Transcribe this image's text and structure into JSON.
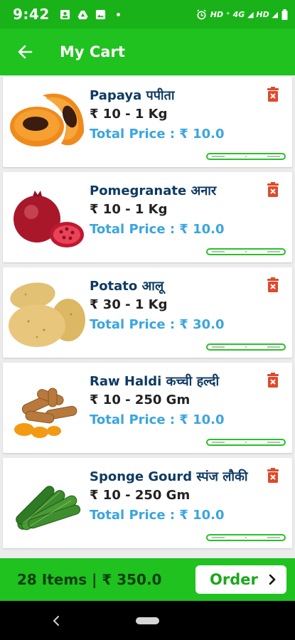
{
  "status_bar": {
    "time": "9:42",
    "right_label": "HD ⁺ 4G ◢ HD ◢"
  },
  "app_bar": {
    "title": "My Cart",
    "back_icon": "arrow-back-icon"
  },
  "cart_items": [
    {
      "name": "Papaya पपीता",
      "unit_price": "₹ 10 - 1 Kg",
      "total": "Total Price : ₹ 10.0",
      "image": "papaya-image"
    },
    {
      "name": "Pomegranate अनार",
      "unit_price": "₹ 10 - 1 Kg",
      "total": "Total Price : ₹ 10.0",
      "image": "pomegranate-image"
    },
    {
      "name": "Potato आलू",
      "unit_price": "₹ 30 - 1 Kg",
      "total": "Total Price : ₹ 30.0",
      "image": "potato-image"
    },
    {
      "name": "Raw Haldi कच्ची हल्दी",
      "unit_price": "₹ 10 - 250 Gm",
      "total": "Total Price : ₹ 10.0",
      "image": "raw-haldi-image"
    },
    {
      "name": "Sponge Gourd स्पंज लौकी",
      "unit_price": "₹ 10 - 250 Gm",
      "total": "Total Price : ₹ 10.0",
      "image": "sponge-gourd-image"
    }
  ],
  "footer": {
    "summary": "28 Items | ₹ 350.0",
    "order_label": "Order"
  },
  "colors": {
    "status_bar": "#19b319",
    "primary": "#1fc21f",
    "item_name": "#0e3a62",
    "total_price": "#3aa5e0",
    "delete": "#e0492a"
  }
}
